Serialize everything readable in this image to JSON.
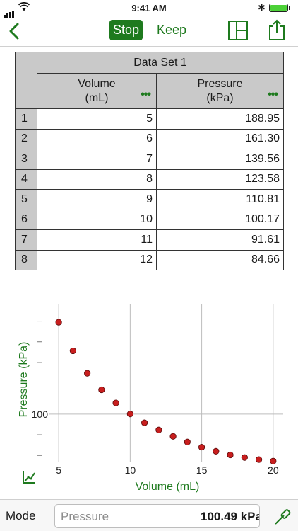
{
  "status_bar": {
    "time": "9:41 AM",
    "bluetooth": "✱",
    "battery_color": "#4cd137"
  },
  "nav": {
    "back_icon": "chevron-left-icon",
    "stop_label": "Stop",
    "keep_label": "Keep",
    "accent_color": "#1e7a1e"
  },
  "table": {
    "dataset_title": "Data Set 1",
    "columns": [
      {
        "name": "Volume",
        "unit": "(mL)",
        "menu": "•••"
      },
      {
        "name": "Pressure",
        "unit": "(kPa)",
        "menu": "•••"
      }
    ],
    "rows": [
      {
        "n": "1",
        "volume": "5",
        "pressure": "188.95"
      },
      {
        "n": "2",
        "volume": "6",
        "pressure": "161.30"
      },
      {
        "n": "3",
        "volume": "7",
        "pressure": "139.56"
      },
      {
        "n": "4",
        "volume": "8",
        "pressure": "123.58"
      },
      {
        "n": "5",
        "volume": "9",
        "pressure": "110.81"
      },
      {
        "n": "6",
        "volume": "10",
        "pressure": "100.17"
      },
      {
        "n": "7",
        "volume": "11",
        "pressure": "91.61"
      },
      {
        "n": "8",
        "volume": "12",
        "pressure": "84.66"
      }
    ]
  },
  "chart_data": {
    "type": "scatter",
    "xlabel": "Volume (mL)",
    "ylabel": "Pressure (kPa)",
    "x_ticks": [
      "5",
      "10",
      "15",
      "20"
    ],
    "y_ticks": [
      "100"
    ],
    "xlim": [
      4.5,
      20.7
    ],
    "ylim": [
      54,
      213
    ],
    "log_y": false,
    "grid": true,
    "marker_color": "#c81e1e",
    "series": [
      {
        "x": [
          5,
          6,
          7,
          8,
          9,
          10,
          11,
          12,
          13,
          14,
          15,
          16,
          17,
          18,
          19,
          20
        ],
        "y": [
          188.95,
          161.3,
          139.56,
          123.58,
          110.81,
          100.17,
          91.61,
          84.66,
          78.5,
          73.0,
          68.0,
          64.0,
          60.5,
          58.0,
          56.0,
          54.5
        ]
      }
    ]
  },
  "bottom_bar": {
    "mode_label": "Mode",
    "meter_name": "Pressure",
    "meter_value": "100.49 kPa"
  }
}
